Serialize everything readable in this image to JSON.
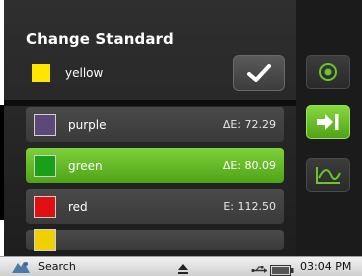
{
  "header": {
    "title": "Change Standard"
  },
  "current_standard": {
    "label": "yellow",
    "color": "#ffe600"
  },
  "confirm_button": {
    "icon": "checkmark-icon"
  },
  "standards_list": [
    {
      "label": "purple",
      "delta_e": "ΔE: 72.29",
      "color": "#5b4a78",
      "selected": false
    },
    {
      "label": "green",
      "delta_e": "ΔE: 80.09",
      "color": "#18a018",
      "selected": true
    },
    {
      "label": "red",
      "delta_e": "E: 112.50",
      "color": "#e01010",
      "selected": false
    },
    {
      "label": "",
      "delta_e": "",
      "color": "#f0d000",
      "selected": false
    }
  ],
  "side_toolbar": {
    "buttons": [
      {
        "icon": "target-icon",
        "active": false
      },
      {
        "icon": "arrow-right-bar-icon",
        "active": true
      },
      {
        "icon": "graph-icon",
        "active": false
      }
    ]
  },
  "taskbar": {
    "search_label": "Search",
    "clock": "03:04 PM",
    "icons": [
      "search-icon",
      "eject-icon",
      "usb-icon",
      "battery-icon"
    ]
  },
  "colors": {
    "accent_green": "#6cc42a",
    "panel_bg": "#2a2a2a"
  }
}
